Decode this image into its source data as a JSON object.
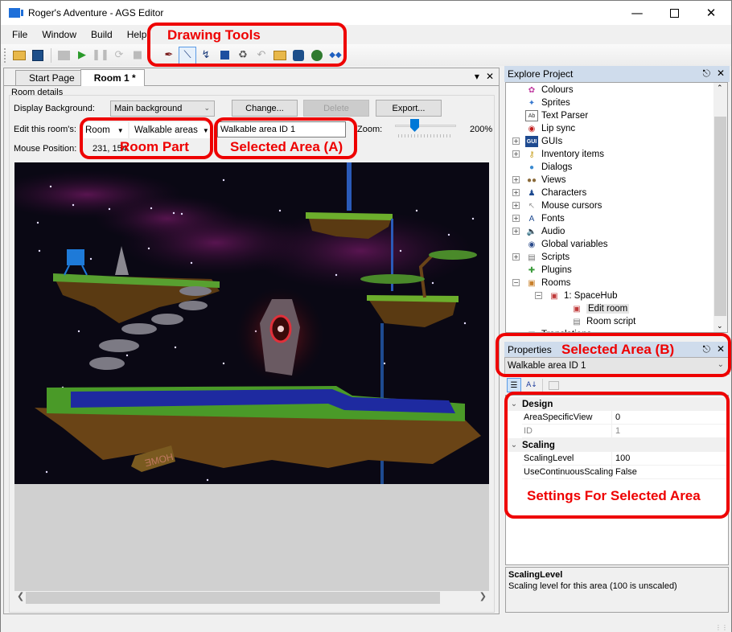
{
  "window": {
    "title": "Roger's Adventure - AGS Editor",
    "minimize_icon": "minimize-icon",
    "maximize_icon": "maximize-icon",
    "close_icon": "close-icon"
  },
  "menu": [
    "File",
    "Window",
    "Build",
    "Help"
  ],
  "toolbar": {
    "file_tools": [
      "open-project-icon",
      "save-icon"
    ],
    "build_tools": [
      "build-exe-icon",
      "run-icon",
      "pause-icon",
      "step-icon",
      "stop-icon"
    ],
    "drawing_tools": [
      "eyedropper-icon",
      "line-tool-icon",
      "freehand-tool-icon",
      "rectangle-tool-icon",
      "fill-tool-icon",
      "undo-icon",
      "import-mask-icon",
      "export-mask-icon",
      "copy-walkable-to-regions-icon",
      "greyed-out-masks-icon"
    ],
    "selected_tool": "line-tool-icon"
  },
  "tabs": [
    {
      "label": "Start Page",
      "active": false
    },
    {
      "label": "Room 1 *",
      "active": true
    }
  ],
  "room_details": {
    "group_label": "Room details",
    "display_background_label": "Display Background:",
    "display_background_value": "Main background",
    "change_button": "Change...",
    "delete_button": "Delete",
    "export_button": "Export...",
    "edit_label": "Edit this room's:",
    "room_part_menu": "Room",
    "area_type_menu": "Walkable areas",
    "selected_area": "Walkable area ID 1",
    "zoom_label": "Zoom:",
    "zoom_value": "200%",
    "zoom_level_fraction": 0.25,
    "mouse_position_label": "Mouse Position:",
    "mouse_position_value": "231, 154"
  },
  "explore_project": {
    "title": "Explore Project",
    "items": [
      {
        "label": "Colours",
        "icon": "colours-icon",
        "expandable": false,
        "depth": 0
      },
      {
        "label": "Sprites",
        "icon": "sprites-icon",
        "expandable": false,
        "depth": 0
      },
      {
        "label": "Text Parser",
        "icon": "text-parser-icon",
        "expandable": false,
        "depth": 0
      },
      {
        "label": "Lip sync",
        "icon": "lip-sync-icon",
        "expandable": false,
        "depth": 0
      },
      {
        "label": "GUIs",
        "icon": "guis-icon",
        "expandable": true,
        "depth": 0
      },
      {
        "label": "Inventory items",
        "icon": "inventory-icon",
        "expandable": true,
        "depth": 0
      },
      {
        "label": "Dialogs",
        "icon": "dialogs-icon",
        "expandable": false,
        "depth": 0
      },
      {
        "label": "Views",
        "icon": "views-icon",
        "expandable": true,
        "depth": 0
      },
      {
        "label": "Characters",
        "icon": "characters-icon",
        "expandable": true,
        "depth": 0
      },
      {
        "label": "Mouse cursors",
        "icon": "mouse-cursors-icon",
        "expandable": true,
        "depth": 0
      },
      {
        "label": "Fonts",
        "icon": "fonts-icon",
        "expandable": true,
        "depth": 0
      },
      {
        "label": "Audio",
        "icon": "audio-icon",
        "expandable": true,
        "depth": 0
      },
      {
        "label": "Global variables",
        "icon": "global-variables-icon",
        "expandable": false,
        "depth": 0
      },
      {
        "label": "Scripts",
        "icon": "scripts-icon",
        "expandable": true,
        "depth": 0
      },
      {
        "label": "Plugins",
        "icon": "plugins-icon",
        "expandable": false,
        "depth": 0
      },
      {
        "label": "Rooms",
        "icon": "rooms-icon",
        "expandable": true,
        "expanded": true,
        "depth": 0
      },
      {
        "label": "1: SpaceHub",
        "icon": "room-icon",
        "expandable": true,
        "expanded": true,
        "depth": 1
      },
      {
        "label": "Edit room",
        "icon": "edit-room-icon",
        "expandable": false,
        "depth": 2,
        "selected": true
      },
      {
        "label": "Room script",
        "icon": "room-script-icon",
        "expandable": false,
        "depth": 2
      },
      {
        "label": "Translations",
        "icon": "translations-icon",
        "expandable": false,
        "depth": 0
      }
    ]
  },
  "properties": {
    "title": "Properties",
    "selected_object": "Walkable area ID 1",
    "categories": [
      {
        "name": "Design",
        "rows": [
          {
            "name": "AreaSpecificView",
            "value": "0",
            "readonly": false
          },
          {
            "name": "ID",
            "value": "1",
            "readonly": true
          }
        ]
      },
      {
        "name": "Scaling",
        "rows": [
          {
            "name": "ScalingLevel",
            "value": "100",
            "readonly": false
          },
          {
            "name": "UseContinuousScaling",
            "value": "False",
            "readonly": false
          }
        ]
      }
    ],
    "help_title": "ScalingLevel",
    "help_text": "Scaling level for this area (100 is unscaled)"
  },
  "annotations": {
    "drawing_tools": "Drawing Tools",
    "room_part": "Room Part",
    "selected_area_a": "Selected Area (A)",
    "selected_area_b": "Selected Area (B)",
    "settings": "Settings For Selected Area",
    "color": "#ee0000"
  }
}
